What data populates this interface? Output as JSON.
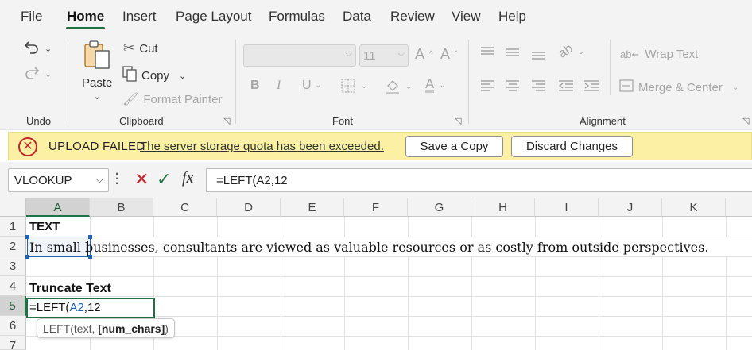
{
  "menu": {
    "items": [
      "File",
      "Home",
      "Insert",
      "Page Layout",
      "Formulas",
      "Data",
      "Review",
      "View",
      "Help"
    ],
    "active": "Home"
  },
  "ribbon": {
    "undo": {
      "group_label": "Undo"
    },
    "clipboard": {
      "group_label": "Clipboard",
      "paste": "Paste",
      "cut": "Cut",
      "copy": "Copy",
      "format_painter": "Format Painter"
    },
    "font": {
      "group_label": "Font",
      "font_name": "",
      "font_size": "11",
      "bold": "B",
      "italic": "I",
      "underline": "U"
    },
    "alignment": {
      "group_label": "Alignment",
      "wrap_text": "Wrap Text",
      "merge_center": "Merge & Center"
    }
  },
  "message_bar": {
    "title": "UPLOAD FAILED",
    "message": "The server storage quota has been exceeded.",
    "save_copy": "Save a Copy",
    "discard": "Discard Changes"
  },
  "formula_bar": {
    "name_box": "VLOOKUP",
    "fx": "fx",
    "formula": "=LEFT(A2,12"
  },
  "grid": {
    "columns": [
      "A",
      "B",
      "C",
      "D",
      "E",
      "F",
      "G",
      "H",
      "I",
      "J",
      "K"
    ],
    "rows": [
      "1",
      "2",
      "3",
      "4",
      "5",
      "6",
      "7"
    ],
    "cells": {
      "A1": "TEXT",
      "A2": "In small businesses, consultants are viewed as valuable resources or as costly from outside perspectives.",
      "A4": "Truncate Text",
      "A5_prefix": "=LEFT(",
      "A5_ref": "A2",
      "A5_suffix": ",12"
    },
    "tooltip": {
      "func": "LEFT(text, ",
      "arg": "[num_chars]",
      "close": ")"
    }
  },
  "colors": {
    "accent": "#1e7145",
    "reference": "#1e64b4",
    "error": "#c4262e",
    "message_bg": "#fcf0a4"
  }
}
